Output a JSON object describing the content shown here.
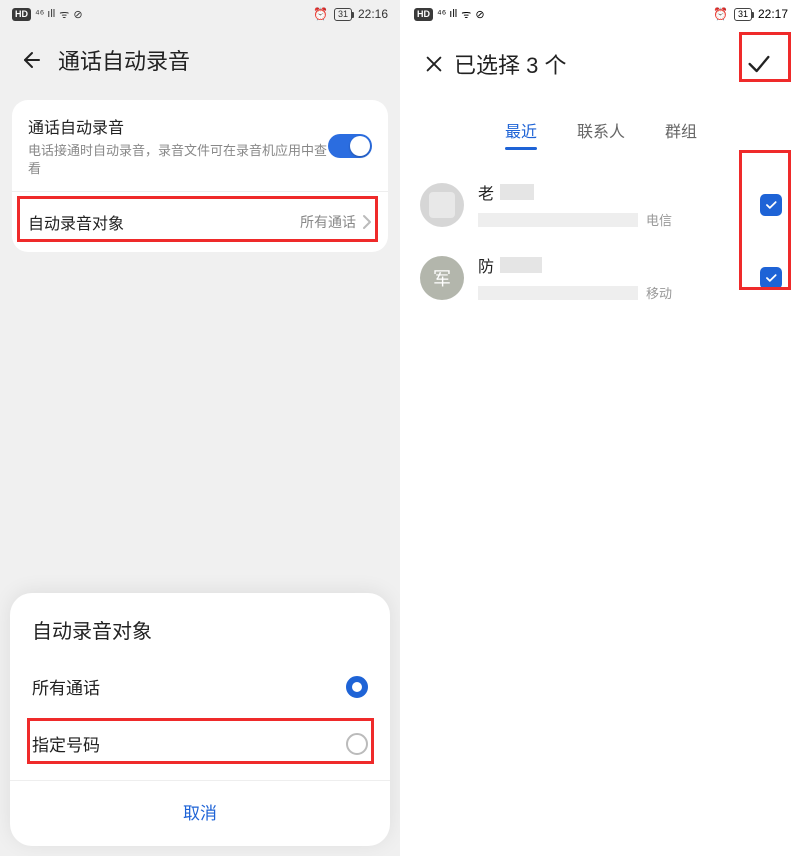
{
  "left": {
    "status": {
      "time": "22:16",
      "battery": "31"
    },
    "title": "通话自动录音",
    "card": {
      "main_title": "通话自动录音",
      "main_desc": "电话接通时自动录音，录音文件可在录音机应用中查看",
      "target_label": "自动录音对象",
      "target_value": "所有通话"
    },
    "sheet": {
      "title": "自动录音对象",
      "options": [
        {
          "label": "所有通话",
          "checked": true
        },
        {
          "label": "指定号码",
          "checked": false
        }
      ],
      "cancel": "取消"
    }
  },
  "right": {
    "status": {
      "time": "22:17",
      "battery": "31"
    },
    "title": "已选择 3 个",
    "tabs": [
      {
        "label": "最近",
        "active": true
      },
      {
        "label": "联系人",
        "active": false
      },
      {
        "label": "群组",
        "active": false
      }
    ],
    "contacts": [
      {
        "avatar_text": "",
        "avatar_class": "av-gray",
        "name_prefix": "老",
        "carrier": "电信",
        "checked": true
      },
      {
        "avatar_text": "军",
        "avatar_class": "av-teal",
        "name_prefix": "防",
        "carrier": "移动",
        "checked": true
      }
    ]
  }
}
